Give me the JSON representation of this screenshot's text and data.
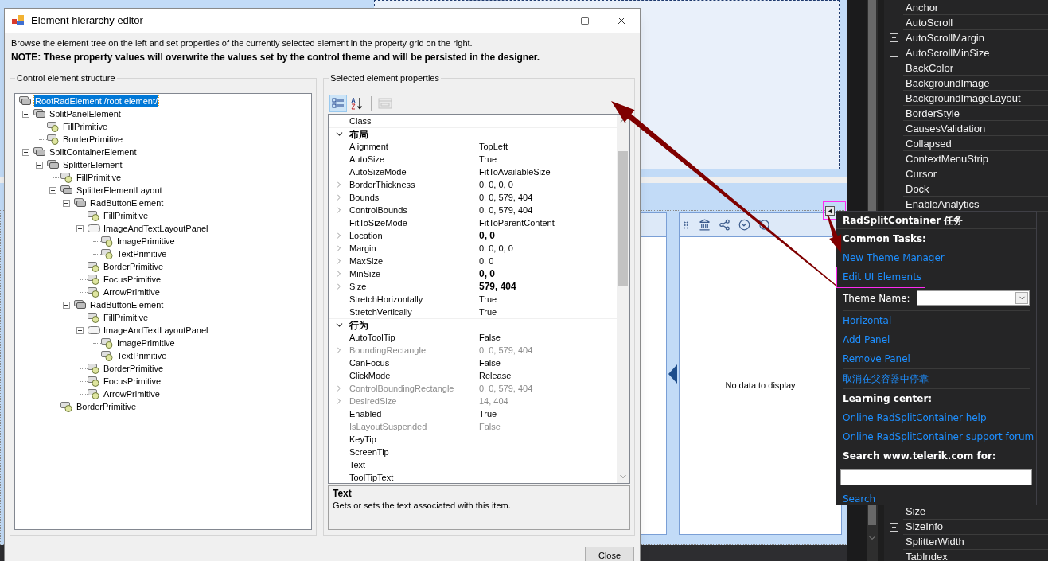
{
  "dialog": {
    "title": "Element hierarchy editor",
    "description": "Browse the element tree on the left and set properties of the currently selected element in the property grid on the right.",
    "note": "NOTE: These property values will overwrite the values set by the control theme and will be persisted in the designer.",
    "tree_group": {
      "title": "Control element structure",
      "nodes": [
        {
          "label": "RootRadElement /root element/",
          "kind": "element",
          "selected": true,
          "children": [
            {
              "label": "SplitPanelElement",
              "kind": "element",
              "selected": false,
              "expanded": true,
              "children": [
                {
                  "label": "FillPrimitive",
                  "kind": "primitive",
                  "selected": false
                },
                {
                  "label": "BorderPrimitive",
                  "kind": "primitive",
                  "selected": false
                }
              ]
            },
            {
              "label": "SplitContainerElement",
              "kind": "element",
              "selected": false,
              "expanded": true,
              "children": [
                {
                  "label": "SplitterElement",
                  "kind": "element",
                  "selected": false,
                  "expanded": true,
                  "children": [
                    {
                      "label": "FillPrimitive",
                      "kind": "primitive",
                      "selected": false
                    },
                    {
                      "label": "SplitterElementLayout",
                      "kind": "element",
                      "selected": false,
                      "expanded": true,
                      "children": [
                        {
                          "label": "RadButtonElement",
                          "kind": "element",
                          "selected": false,
                          "expanded": true,
                          "children": [
                            {
                              "label": "FillPrimitive",
                              "kind": "primitive",
                              "selected": false
                            },
                            {
                              "label": "ImageAndTextLayoutPanel",
                              "kind": "panel",
                              "selected": false,
                              "expanded": true,
                              "children": [
                                {
                                  "label": "ImagePrimitive",
                                  "kind": "primitive",
                                  "selected": false
                                },
                                {
                                  "label": "TextPrimitive",
                                  "kind": "primitive",
                                  "selected": false
                                }
                              ]
                            },
                            {
                              "label": "BorderPrimitive",
                              "kind": "primitive",
                              "selected": false
                            },
                            {
                              "label": "FocusPrimitive",
                              "kind": "primitive",
                              "selected": false
                            },
                            {
                              "label": "ArrowPrimitive",
                              "kind": "primitive",
                              "selected": false
                            }
                          ]
                        },
                        {
                          "label": "RadButtonElement",
                          "kind": "element",
                          "selected": false,
                          "expanded": true,
                          "children": [
                            {
                              "label": "FillPrimitive",
                              "kind": "primitive",
                              "selected": false
                            },
                            {
                              "label": "ImageAndTextLayoutPanel",
                              "kind": "panel",
                              "selected": false,
                              "expanded": true,
                              "children": [
                                {
                                  "label": "ImagePrimitive",
                                  "kind": "primitive",
                                  "selected": false
                                },
                                {
                                  "label": "TextPrimitive",
                                  "kind": "primitive",
                                  "selected": false
                                }
                              ]
                            },
                            {
                              "label": "BorderPrimitive",
                              "kind": "primitive",
                              "selected": false
                            },
                            {
                              "label": "FocusPrimitive",
                              "kind": "primitive",
                              "selected": false
                            },
                            {
                              "label": "ArrowPrimitive",
                              "kind": "primitive",
                              "selected": false
                            }
                          ]
                        }
                      ]
                    },
                    {
                      "label": "BorderPrimitive",
                      "kind": "primitive",
                      "selected": false
                    }
                  ]
                }
              ]
            }
          ]
        }
      ]
    },
    "properties_group": {
      "title": "Selected element properties",
      "toolbar": [
        {
          "kind": "categorized",
          "selected": true,
          "disabled": false
        },
        {
          "kind": "alphabetical",
          "selected": false,
          "disabled": false
        },
        {
          "kind": "pages",
          "selected": false,
          "disabled": true
        }
      ],
      "rows": [
        {
          "kind": "property",
          "name": "Class",
          "expandable": false,
          "readonly": false
        },
        {
          "kind": "category",
          "name": "布局",
          "expanded": true
        },
        {
          "kind": "property",
          "name": "Alignment",
          "value": "TopLeft",
          "expandable": false,
          "readonly": false,
          "modified": false
        },
        {
          "kind": "property",
          "name": "AutoSize",
          "value": "True",
          "expandable": false,
          "readonly": false,
          "modified": false
        },
        {
          "kind": "property",
          "name": "AutoSizeMode",
          "value": "FitToAvailableSize",
          "expandable": false,
          "readonly": false,
          "modified": false
        },
        {
          "kind": "property",
          "name": "BorderThickness",
          "value": "0, 0, 0, 0",
          "expandable": true,
          "readonly": false,
          "modified": false
        },
        {
          "kind": "property",
          "name": "Bounds",
          "value": "0, 0, 579, 404",
          "expandable": true,
          "readonly": false,
          "modified": false
        },
        {
          "kind": "property",
          "name": "ControlBounds",
          "value": "0, 0, 579, 404",
          "expandable": true,
          "readonly": false,
          "modified": false
        },
        {
          "kind": "property",
          "name": "FitToSizeMode",
          "value": "FitToParentContent",
          "expandable": false,
          "readonly": false,
          "modified": false
        },
        {
          "kind": "property",
          "name": "Location",
          "value": "0, 0",
          "expandable": true,
          "readonly": false,
          "modified": true
        },
        {
          "kind": "property",
          "name": "Margin",
          "value": "0, 0, 0, 0",
          "expandable": true,
          "readonly": false,
          "modified": false
        },
        {
          "kind": "property",
          "name": "MaxSize",
          "value": "0, 0",
          "expandable": true,
          "readonly": false,
          "modified": false
        },
        {
          "kind": "property",
          "name": "MinSize",
          "value": "0, 0",
          "expandable": true,
          "readonly": false,
          "modified": true
        },
        {
          "kind": "property",
          "name": "Size",
          "value": "579, 404",
          "expandable": true,
          "readonly": false,
          "modified": true
        },
        {
          "kind": "property",
          "name": "StretchHorizontally",
          "value": "True",
          "expandable": false,
          "readonly": false,
          "modified": false
        },
        {
          "kind": "property",
          "name": "StretchVertically",
          "value": "True",
          "expandable": false,
          "readonly": false,
          "modified": false
        },
        {
          "kind": "category",
          "name": "行为",
          "expanded": true
        },
        {
          "kind": "property",
          "name": "AutoToolTip",
          "value": "False",
          "expandable": false,
          "readonly": false,
          "modified": false
        },
        {
          "kind": "property",
          "name": "BoundingRectangle",
          "value": "0, 0, 579, 404",
          "expandable": true,
          "readonly": true,
          "modified": false
        },
        {
          "kind": "property",
          "name": "CanFocus",
          "value": "False",
          "expandable": false,
          "readonly": false,
          "modified": false
        },
        {
          "kind": "property",
          "name": "ClickMode",
          "value": "Release",
          "expandable": false,
          "readonly": false,
          "modified": false
        },
        {
          "kind": "property",
          "name": "ControlBoundingRectangle",
          "value": "0, 0, 579, 404",
          "expandable": true,
          "readonly": true,
          "modified": false
        },
        {
          "kind": "property",
          "name": "DesiredSize",
          "value": "14, 404",
          "expandable": true,
          "readonly": true,
          "modified": false
        },
        {
          "kind": "property",
          "name": "Enabled",
          "value": "True",
          "expandable": false,
          "readonly": false,
          "modified": false
        },
        {
          "kind": "property",
          "name": "IsLayoutSuspended",
          "value": "False",
          "expandable": false,
          "readonly": true,
          "modified": false
        },
        {
          "kind": "property",
          "name": "KeyTip",
          "expandable": false,
          "readonly": false
        },
        {
          "kind": "property",
          "name": "ScreenTip",
          "expandable": false,
          "readonly": false
        },
        {
          "kind": "property",
          "name": "Text",
          "expandable": false,
          "readonly": false
        },
        {
          "kind": "property",
          "name": "ToolTipText",
          "expandable": false,
          "readonly": false
        }
      ],
      "help_title": "Text",
      "help_text": "Gets or sets the text associated with this item."
    },
    "buttons": [
      "Close"
    ]
  },
  "designer": {
    "empty_text": "No data to display"
  },
  "property_list_top": [
    {
      "name": "Anchor",
      "expandable": false
    },
    {
      "name": "AutoScroll",
      "expandable": false
    },
    {
      "name": "AutoScrollMargin",
      "expandable": true
    },
    {
      "name": "AutoScrollMinSize",
      "expandable": true
    },
    {
      "name": "BackColor",
      "expandable": false
    },
    {
      "name": "BackgroundImage",
      "expandable": false
    },
    {
      "name": "BackgroundImageLayout",
      "expandable": false
    },
    {
      "name": "BorderStyle",
      "expandable": false
    },
    {
      "name": "CausesValidation",
      "expandable": false
    },
    {
      "name": "Collapsed",
      "expandable": false
    },
    {
      "name": "ContextMenuStrip",
      "expandable": false
    },
    {
      "name": "Cursor",
      "expandable": false
    },
    {
      "name": "Dock",
      "expandable": false
    },
    {
      "name": "EnableAnalytics",
      "expandable": false
    }
  ],
  "property_list_bottom": [
    {
      "name": "Size",
      "expandable": true
    },
    {
      "name": "SizeInfo",
      "expandable": true
    },
    {
      "name": "SplitterWidth",
      "expandable": false
    },
    {
      "name": "TabIndex",
      "expandable": false
    }
  ],
  "smart_tag": {
    "title": "RadSplitContainer 任务",
    "items": [
      {
        "kind": "heading",
        "text": "Common Tasks:"
      },
      {
        "kind": "link",
        "text": "New Theme Manager"
      },
      {
        "kind": "link",
        "text": "Edit UI Elements",
        "highlighted": true
      },
      {
        "kind": "combo",
        "label": "Theme Name:"
      },
      {
        "kind": "divider"
      },
      {
        "kind": "link",
        "text": "Horizontal"
      },
      {
        "kind": "link",
        "text": "Add Panel"
      },
      {
        "kind": "link",
        "text": "Remove Panel"
      },
      {
        "kind": "divider"
      },
      {
        "kind": "link",
        "text": "取消在父容器中停靠"
      },
      {
        "kind": "divider"
      },
      {
        "kind": "heading",
        "text": "Learning center:"
      },
      {
        "kind": "link",
        "text": "Online RadSplitContainer help"
      },
      {
        "kind": "link",
        "text": "Online RadSplitContainer support forum"
      },
      {
        "kind": "heading",
        "text": "Search www.telerik.com for:"
      },
      {
        "kind": "input"
      },
      {
        "kind": "link",
        "text": "Search"
      }
    ]
  }
}
